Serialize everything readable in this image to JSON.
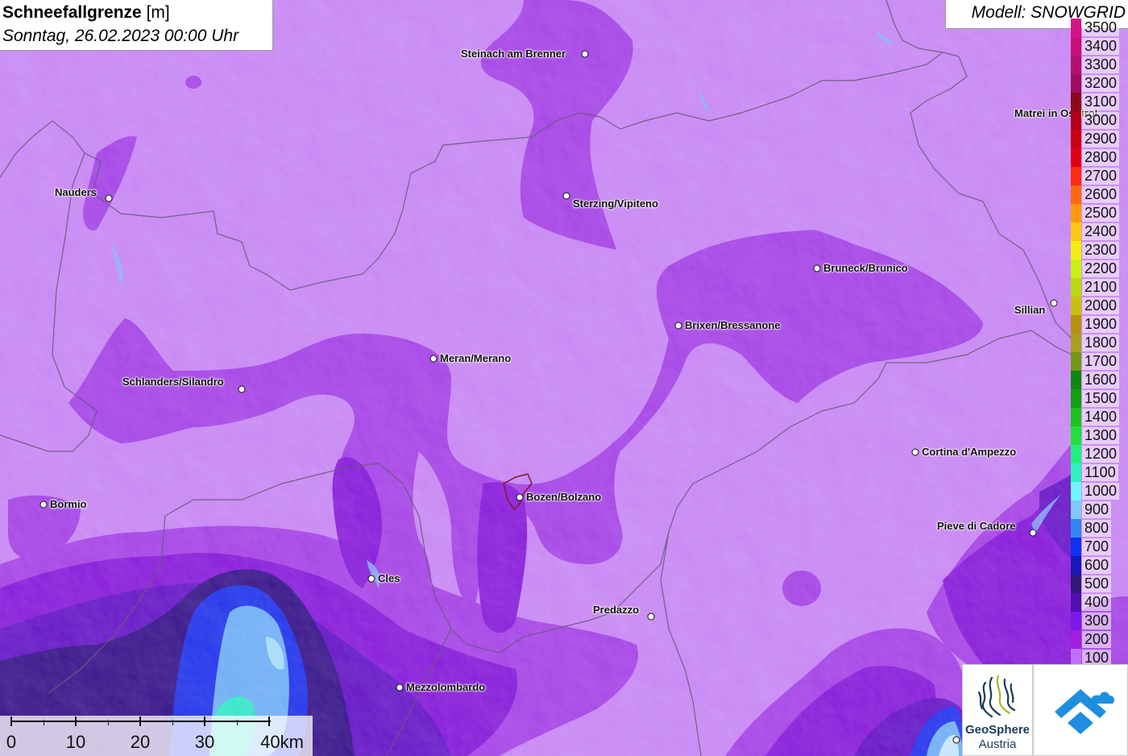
{
  "header": {
    "title_bold": "Schneefallgrenze",
    "title_unit": " [m]",
    "subtitle": "Sonntag, 26.02.2023 00:00 Uhr",
    "model_label": "Modell: SNOWGRID"
  },
  "legend": {
    "top_partial": "3500",
    "levels": [
      {
        "value": "3400",
        "color": "#c8107a"
      },
      {
        "value": "3300",
        "color": "#b3106e"
      },
      {
        "value": "3200",
        "color": "#a00c5e"
      },
      {
        "value": "3100",
        "color": "#8b0a1a"
      },
      {
        "value": "3000",
        "color": "#b0001a"
      },
      {
        "value": "2900",
        "color": "#cc0010"
      },
      {
        "value": "2800",
        "color": "#e00010"
      },
      {
        "value": "2700",
        "color": "#ff2a10"
      },
      {
        "value": "2600",
        "color": "#ff6a10"
      },
      {
        "value": "2500",
        "color": "#ff9a10"
      },
      {
        "value": "2400",
        "color": "#ffc810"
      },
      {
        "value": "2300",
        "color": "#f0f010"
      },
      {
        "value": "2200",
        "color": "#c8f010"
      },
      {
        "value": "2100",
        "color": "#b8d810"
      },
      {
        "value": "2000",
        "color": "#c8c010"
      },
      {
        "value": "1900",
        "color": "#b89010"
      },
      {
        "value": "1800",
        "color": "#a8a020"
      },
      {
        "value": "1700",
        "color": "#709818"
      },
      {
        "value": "1600",
        "color": "#108810"
      },
      {
        "value": "1500",
        "color": "#10a010"
      },
      {
        "value": "1400",
        "color": "#20c020"
      },
      {
        "value": "1300",
        "color": "#20e040"
      },
      {
        "value": "1200",
        "color": "#20f080"
      },
      {
        "value": "1100",
        "color": "#30f0c0"
      },
      {
        "value": "1000",
        "color": "#70f8f8"
      },
      {
        "value": "900",
        "color": "#80c8f8"
      },
      {
        "value": "800",
        "color": "#3088f0"
      },
      {
        "value": "700",
        "color": "#1030f0"
      },
      {
        "value": "600",
        "color": "#1818b8"
      },
      {
        "value": "500",
        "color": "#301878"
      },
      {
        "value": "400",
        "color": "#5010b0"
      },
      {
        "value": "300",
        "color": "#7a18e8"
      },
      {
        "value": "200",
        "color": "#a020e0"
      },
      {
        "value": "100",
        "color": "#c070f8"
      }
    ]
  },
  "cities": [
    {
      "name": "Steinach am Brenner",
      "label_side": "left"
    },
    {
      "name": "Matrei in Osttirol",
      "label_side": "left"
    },
    {
      "name": "Nauders",
      "label_side": "left"
    },
    {
      "name": "Sterzing/Vipiteno",
      "label_side": "right"
    },
    {
      "name": "Bruneck/Brunico",
      "label_side": "right"
    },
    {
      "name": "Sillian",
      "label_side": "left"
    },
    {
      "name": "Brixen/Bressanone",
      "label_side": "right"
    },
    {
      "name": "Meran/Merano",
      "label_side": "right"
    },
    {
      "name": "Schlanders/Silandro",
      "label_side": "left"
    },
    {
      "name": "Cortina d'Ampezzo",
      "label_side": "right"
    },
    {
      "name": "Bormio",
      "label_side": "right"
    },
    {
      "name": "Bozen/Bolzano",
      "label_side": "right"
    },
    {
      "name": "Pieve di Cadore",
      "label_side": "left"
    },
    {
      "name": "Cles",
      "label_side": "right"
    },
    {
      "name": "Predazzo",
      "label_side": "left"
    },
    {
      "name": "Mezzolombardo",
      "label_side": "right"
    }
  ],
  "scale": {
    "labels": [
      "0",
      "10",
      "20",
      "30",
      "40km"
    ]
  },
  "logos": {
    "geosphere_line1": "GeoSphere",
    "geosphere_line2": "Austria"
  },
  "colors": {
    "base": "#c98bf4",
    "mid": "#a444e4",
    "dark": "#8a1ed8",
    "deep": "#6418c8",
    "navy": "#3a1e8a",
    "blue": "#2848f0",
    "light_blue": "#80c8f8",
    "cyan": "#40f0c8"
  }
}
